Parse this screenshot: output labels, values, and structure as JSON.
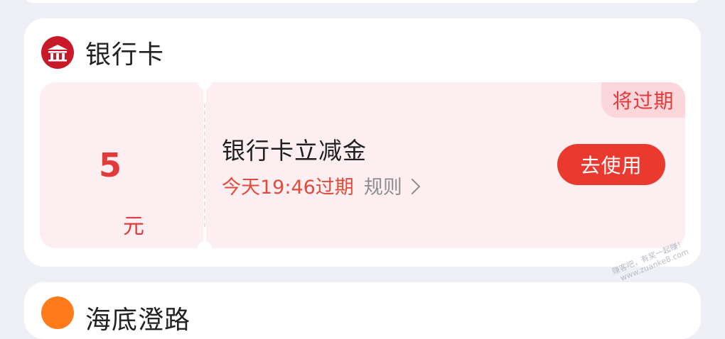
{
  "bank_section": {
    "title": "银行卡",
    "logo_icon": "bank-logo-icon"
  },
  "coupon": {
    "amount": "5",
    "unit": "元",
    "badge": "将过期",
    "title": "银行卡立减金",
    "expire": "今天19:46过期",
    "rules": "规则",
    "action": "去使用"
  },
  "next_section": {
    "title": "海底澄路"
  },
  "watermark": {
    "line1": "赚客吧，有奖一起赚！",
    "line2": "www.zuanke8.com"
  },
  "colors": {
    "accent_red": "#ea3a30",
    "coupon_bg": "#fdeff1",
    "badge_bg": "#fbd7db",
    "logo_red": "#c8182a"
  }
}
